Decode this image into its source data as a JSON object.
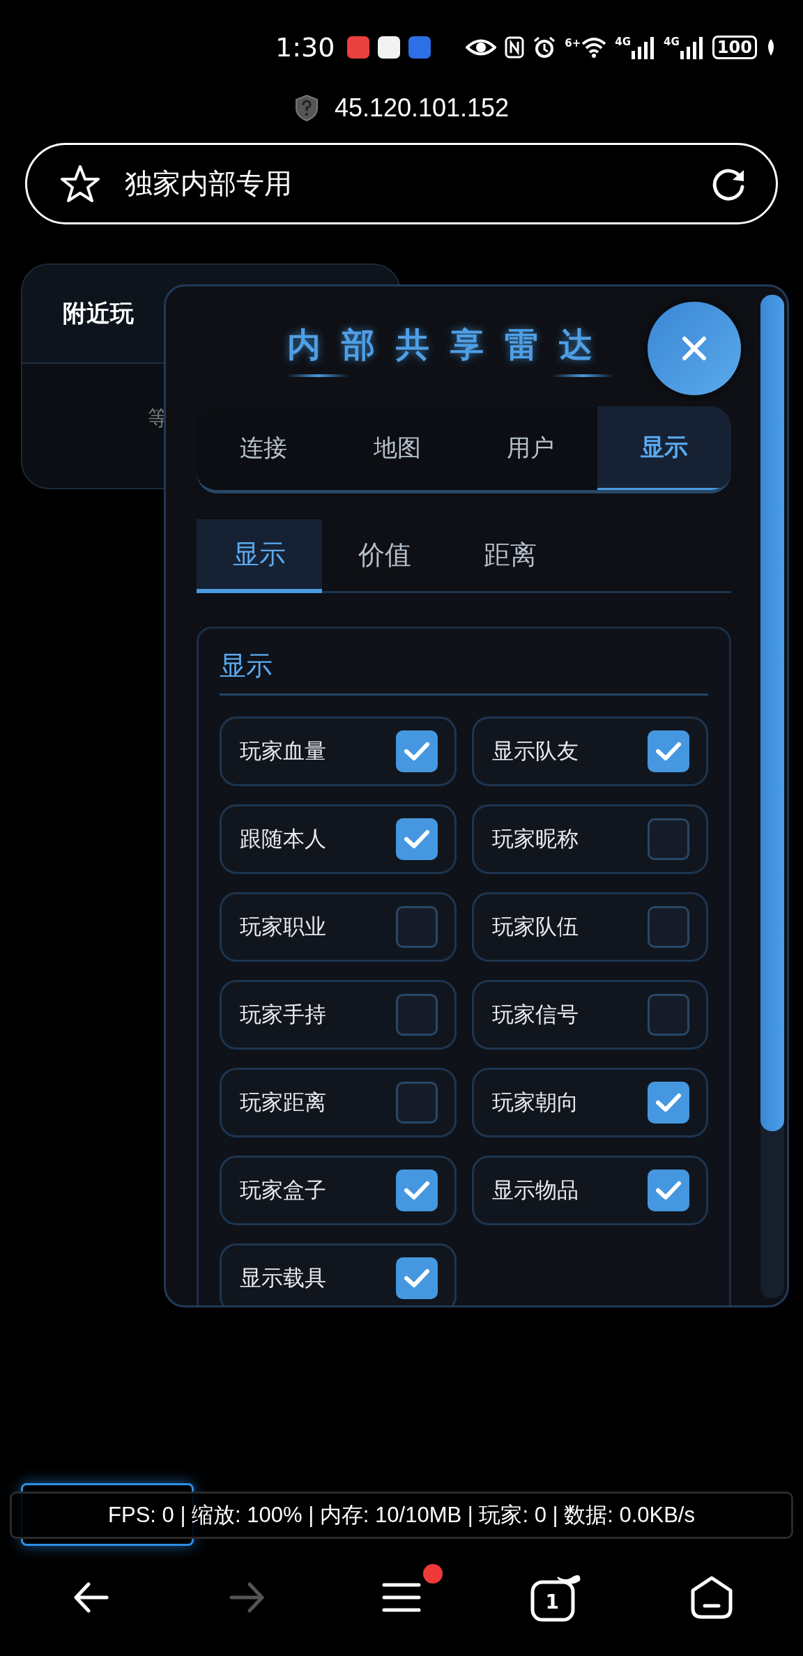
{
  "status_bar": {
    "time": "1:30",
    "wifi_label": "6+",
    "signal_labels": [
      "4G",
      "4G"
    ],
    "battery": "100"
  },
  "address": {
    "host": "45.120.101.152",
    "page_title": "独家内部专用"
  },
  "nearby_card": {
    "title": "附近玩",
    "body": "等"
  },
  "panel": {
    "title": "内部共享雷达",
    "tabs": [
      {
        "label": "连接",
        "selected": false
      },
      {
        "label": "地图",
        "selected": false
      },
      {
        "label": "用户",
        "selected": false
      },
      {
        "label": "显示",
        "selected": true
      }
    ],
    "subtabs": [
      {
        "label": "显示",
        "selected": true
      },
      {
        "label": "价值",
        "selected": false
      },
      {
        "label": "距离",
        "selected": false
      }
    ],
    "section": {
      "title": "显示",
      "options": [
        {
          "label": "玩家血量",
          "checked": true
        },
        {
          "label": "显示队友",
          "checked": true
        },
        {
          "label": "跟随本人",
          "checked": true
        },
        {
          "label": "玩家昵称",
          "checked": false
        },
        {
          "label": "玩家职业",
          "checked": false
        },
        {
          "label": "玩家队伍",
          "checked": false
        },
        {
          "label": "玩家手持",
          "checked": false
        },
        {
          "label": "玩家信号",
          "checked": false
        },
        {
          "label": "玩家距离",
          "checked": false
        },
        {
          "label": "玩家朝向",
          "checked": true
        },
        {
          "label": "玩家盒子",
          "checked": true
        },
        {
          "label": "显示物品",
          "checked": true
        },
        {
          "label": "显示载具",
          "checked": true
        }
      ]
    }
  },
  "stats_bar": {
    "text": "FPS: 0 | 缩放: 100% | 内存: 10/10MB | 玩家: 0 | 数据: 0.0KB/s"
  },
  "nav": [
    {
      "kind": "back",
      "disabled": false
    },
    {
      "kind": "forward",
      "disabled": true
    },
    {
      "kind": "menu",
      "badge": true
    },
    {
      "kind": "tabs",
      "count": "1"
    },
    {
      "kind": "home"
    }
  ]
}
